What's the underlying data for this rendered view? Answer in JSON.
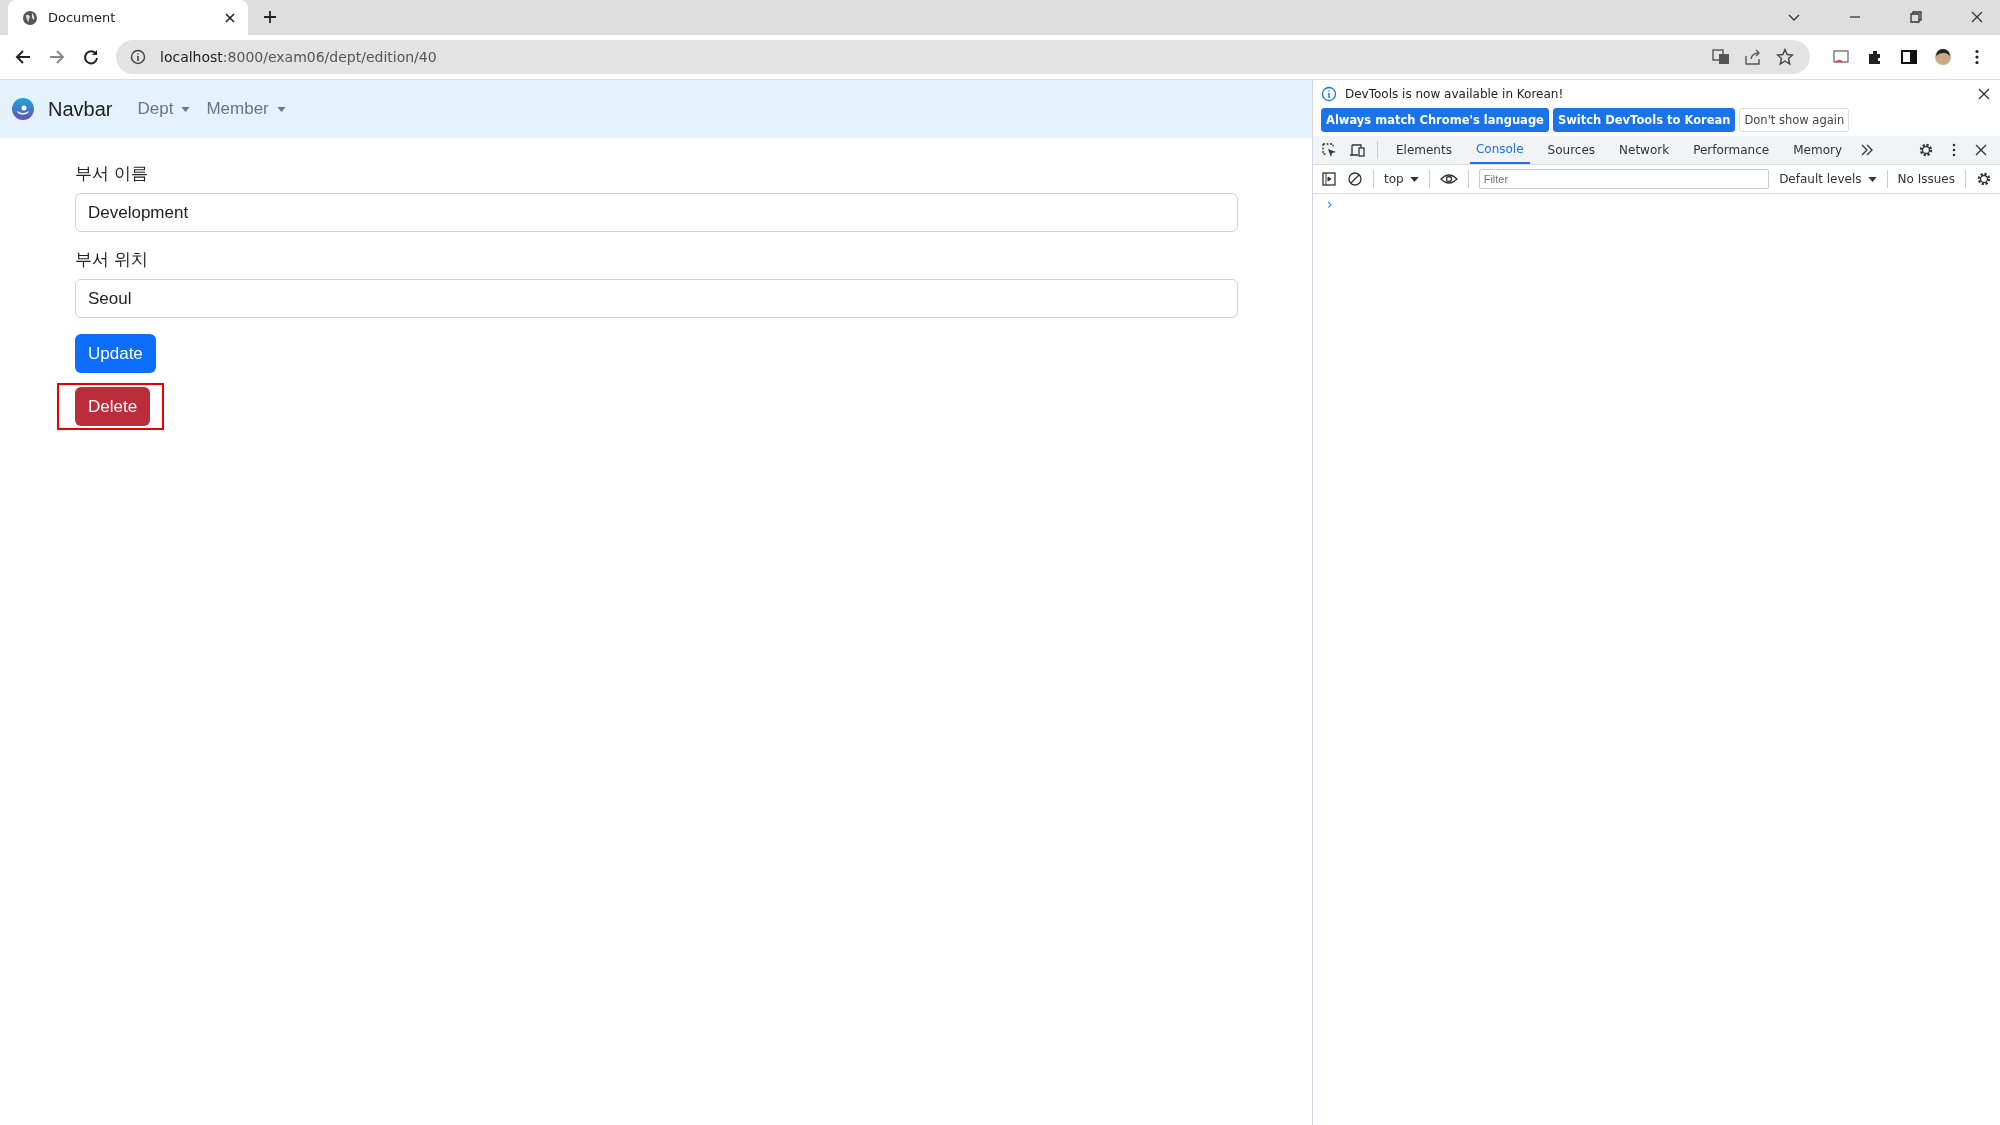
{
  "browser": {
    "tabs": [
      {
        "title": "Document",
        "selected": true
      }
    ],
    "address": {
      "host": "localhost",
      "rest": ":8000/exam06/dept/edition/40"
    }
  },
  "navbar": {
    "brand": "Navbar",
    "menus": [
      {
        "label": "Dept"
      },
      {
        "label": "Member"
      }
    ]
  },
  "form": {
    "fields": [
      {
        "label": "부서 이름",
        "value": "Development"
      },
      {
        "label": "부서 위치",
        "value": "Seoul"
      }
    ],
    "buttons": [
      {
        "label": "Update",
        "kind": "primary",
        "highlighted": false
      },
      {
        "label": "Delete",
        "kind": "danger",
        "highlighted": true
      }
    ]
  },
  "devtools": {
    "notice": "DevTools is now available in Korean!",
    "notice_buttons": [
      {
        "label": "Always match Chrome's language",
        "kind": "primary"
      },
      {
        "label": "Switch DevTools to Korean",
        "kind": "primary"
      },
      {
        "label": "Don't show again",
        "kind": "plain"
      }
    ],
    "tabs": [
      {
        "label": "Elements",
        "selected": false
      },
      {
        "label": "Console",
        "selected": true
      },
      {
        "label": "Sources",
        "selected": false
      },
      {
        "label": "Network",
        "selected": false
      },
      {
        "label": "Performance",
        "selected": false
      },
      {
        "label": "Memory",
        "selected": false
      }
    ],
    "context": "top",
    "filter_placeholder": "Filter",
    "levels": "Default levels",
    "issues": "No Issues",
    "prompt": "›"
  }
}
